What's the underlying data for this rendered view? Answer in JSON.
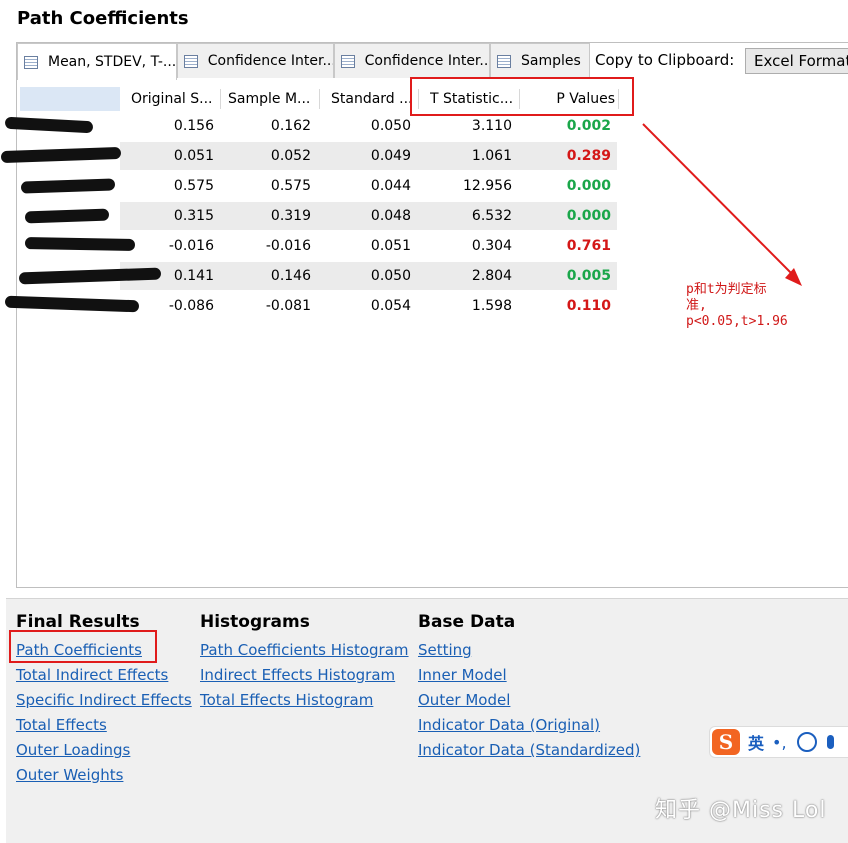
{
  "page_title": "Path Coefficients",
  "tabs": [
    {
      "label": "Mean, STDEV, T-...",
      "icon": "table-icon"
    },
    {
      "label": "Confidence Inter...",
      "icon": "table-icon"
    },
    {
      "label": "Confidence Inter...",
      "icon": "table-icon"
    },
    {
      "label": "Samples",
      "icon": "table-icon"
    }
  ],
  "clipboard": {
    "label": "Copy to Clipboard:",
    "button": "Excel Format"
  },
  "table": {
    "columns": [
      "Original S...",
      "Sample M...",
      "Standard ...",
      "T Statistic...",
      "P Values"
    ],
    "rows": [
      {
        "original": "0.156",
        "mean": "0.162",
        "stdev": "0.050",
        "t": "3.110",
        "p": "0.002",
        "p_color": "#1aa64a"
      },
      {
        "original": "0.051",
        "mean": "0.052",
        "stdev": "0.049",
        "t": "1.061",
        "p": "0.289",
        "p_color": "#d41717"
      },
      {
        "original": "0.575",
        "mean": "0.575",
        "stdev": "0.044",
        "t": "12.956",
        "p": "0.000",
        "p_color": "#1aa64a"
      },
      {
        "original": "0.315",
        "mean": "0.319",
        "stdev": "0.048",
        "t": "6.532",
        "p": "0.000",
        "p_color": "#1aa64a"
      },
      {
        "original": "-0.016",
        "mean": "-0.016",
        "stdev": "0.051",
        "t": "0.304",
        "p": "0.761",
        "p_color": "#d41717"
      },
      {
        "original": "0.141",
        "mean": "0.146",
        "stdev": "0.050",
        "t": "2.804",
        "p": "0.005",
        "p_color": "#1aa64a"
      },
      {
        "original": "-0.086",
        "mean": "-0.081",
        "stdev": "0.054",
        "t": "1.598",
        "p": "0.110",
        "p_color": "#d41717"
      }
    ]
  },
  "annotation": "p和t为判定标\n准,\np<0.05,t>1.96",
  "bottom": {
    "final_results": {
      "heading": "Final Results",
      "links": [
        "Path Coefficients",
        "Total Indirect Effects",
        "Specific Indirect Effects",
        "Total Effects",
        "Outer Loadings",
        "Outer Weights"
      ]
    },
    "histograms": {
      "heading": "Histograms",
      "links": [
        "Path Coefficients Histogram",
        "Indirect Effects Histogram",
        "Total Effects Histogram"
      ]
    },
    "base_data": {
      "heading": "Base Data",
      "links": [
        "Setting",
        "Inner Model",
        "Outer Model",
        "Indicator Data (Original)",
        "Indicator Data (Standardized)"
      ]
    }
  },
  "ime": {
    "logo": "S",
    "lang": "英",
    "punct": "•,"
  },
  "watermark": "知乎 @Miss Lol",
  "colors": {
    "significant": "#1aa64a",
    "not_significant": "#d41717",
    "highlight_box": "#e01b1b",
    "link": "#1a5fb4"
  }
}
